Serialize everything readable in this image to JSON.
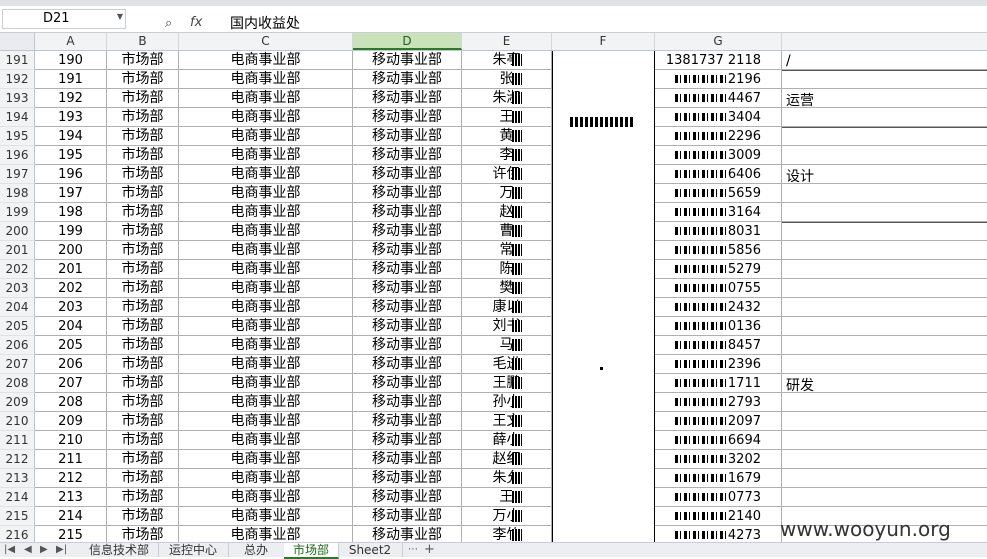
{
  "formula_bar": {
    "name_box": "D21",
    "content": "国内收益处"
  },
  "columns": [
    "A",
    "B",
    "C",
    "D",
    "E",
    "F",
    "G"
  ],
  "active_column": "D",
  "rows": [
    {
      "row": "191",
      "a": "190",
      "b": "市场部",
      "c": "电商事业部",
      "d": "移动事业部",
      "e": "朱亭",
      "g": "1381737 2118"
    },
    {
      "row": "192",
      "a": "191",
      "b": "市场部",
      "c": "电商事业部",
      "d": "移动事业部",
      "e": "张",
      "g": "2196"
    },
    {
      "row": "193",
      "a": "192",
      "b": "市场部",
      "c": "电商事业部",
      "d": "移动事业部",
      "e": "朱淑",
      "g": "4467"
    },
    {
      "row": "194",
      "a": "193",
      "b": "市场部",
      "c": "电商事业部",
      "d": "移动事业部",
      "e": "王",
      "g": "3404"
    },
    {
      "row": "195",
      "a": "194",
      "b": "市场部",
      "c": "电商事业部",
      "d": "移动事业部",
      "e": "黄",
      "g": "2296"
    },
    {
      "row": "196",
      "a": "195",
      "b": "市场部",
      "c": "电商事业部",
      "d": "移动事业部",
      "e": "李",
      "g": "3009"
    },
    {
      "row": "197",
      "a": "196",
      "b": "市场部",
      "c": "电商事业部",
      "d": "移动事业部",
      "e": "许伊",
      "g": "6406"
    },
    {
      "row": "198",
      "a": "197",
      "b": "市场部",
      "c": "电商事业部",
      "d": "移动事业部",
      "e": "万",
      "g": "5659"
    },
    {
      "row": "199",
      "a": "198",
      "b": "市场部",
      "c": "电商事业部",
      "d": "移动事业部",
      "e": "赵",
      "g": "3164"
    },
    {
      "row": "200",
      "a": "199",
      "b": "市场部",
      "c": "电商事业部",
      "d": "移动事业部",
      "e": "曹",
      "g": "8031"
    },
    {
      "row": "201",
      "a": "200",
      "b": "市场部",
      "c": "电商事业部",
      "d": "移动事业部",
      "e": "常",
      "g": "5856"
    },
    {
      "row": "202",
      "a": "201",
      "b": "市场部",
      "c": "电商事业部",
      "d": "移动事业部",
      "e": "陈",
      "g": "5279"
    },
    {
      "row": "203",
      "a": "202",
      "b": "市场部",
      "c": "电商事业部",
      "d": "移动事业部",
      "e": "樊",
      "g": "0755"
    },
    {
      "row": "204",
      "a": "203",
      "b": "市场部",
      "c": "电商事业部",
      "d": "移动事业部",
      "e": "康以",
      "g": "2432"
    },
    {
      "row": "205",
      "a": "204",
      "b": "市场部",
      "c": "电商事业部",
      "d": "移动事业部",
      "e": "刘书",
      "g": "0136"
    },
    {
      "row": "206",
      "a": "205",
      "b": "市场部",
      "c": "电商事业部",
      "d": "移动事业部",
      "e": "马",
      "g": "8457"
    },
    {
      "row": "207",
      "a": "206",
      "b": "市场部",
      "c": "电商事业部",
      "d": "移动事业部",
      "e": "毛进",
      "g": "2396"
    },
    {
      "row": "208",
      "a": "207",
      "b": "市场部",
      "c": "电商事业部",
      "d": "移动事业部",
      "e": "王鹏",
      "g": "1711"
    },
    {
      "row": "209",
      "a": "208",
      "b": "市场部",
      "c": "电商事业部",
      "d": "移动事业部",
      "e": "孙小",
      "g": "2793"
    },
    {
      "row": "210",
      "a": "209",
      "b": "市场部",
      "c": "电商事业部",
      "d": "移动事业部",
      "e": "王文",
      "g": "2097"
    },
    {
      "row": "211",
      "a": "210",
      "b": "市场部",
      "c": "电商事业部",
      "d": "移动事业部",
      "e": "薛小",
      "g": "6694"
    },
    {
      "row": "212",
      "a": "211",
      "b": "市场部",
      "c": "电商事业部",
      "d": "移动事业部",
      "e": "赵红",
      "g": "3202"
    },
    {
      "row": "213",
      "a": "212",
      "b": "市场部",
      "c": "电商事业部",
      "d": "移动事业部",
      "e": "朱允",
      "g": "1679"
    },
    {
      "row": "214",
      "a": "213",
      "b": "市场部",
      "c": "电商事业部",
      "d": "移动事业部",
      "e": "王",
      "g": "0773"
    },
    {
      "row": "215",
      "a": "214",
      "b": "市场部",
      "c": "电商事业部",
      "d": "移动事业部",
      "e": "万小",
      "g": "2140"
    },
    {
      "row": "216",
      "a": "215",
      "b": "市场部",
      "c": "电商事业部",
      "d": "移动事业部",
      "e": "李竹",
      "g": "4273"
    }
  ],
  "h_labels": {
    "slash": "/",
    "yunying": "运营",
    "sheji": "设计",
    "yanfa": "研发"
  },
  "sheet_tabs": [
    "信息技术部",
    "运控中心",
    "总办",
    "市场部",
    "Sheet2"
  ],
  "active_sheet": "市场部",
  "watermark": "www.wooyun.org",
  "colors": {
    "active_column_header": "#c9e2b9",
    "active_tab_accent": "#2b7a2b"
  }
}
